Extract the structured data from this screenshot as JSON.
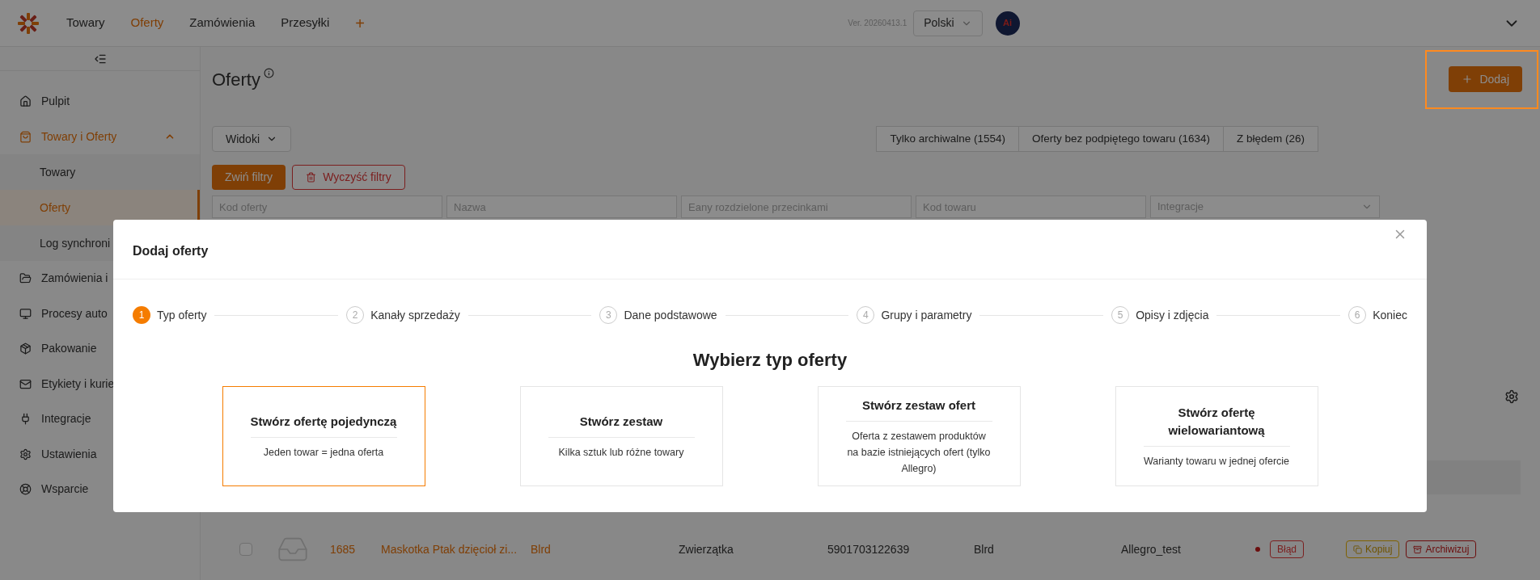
{
  "topbar": {
    "nav": [
      {
        "label": "Towary",
        "selected": false
      },
      {
        "label": "Oferty",
        "selected": true
      },
      {
        "label": "Zamówienia",
        "selected": false
      },
      {
        "label": "Przesyłki",
        "selected": false
      }
    ],
    "add_tab": "+",
    "version": "Ver. 20260413.1",
    "language": "Polski",
    "avatar_label": "Ai"
  },
  "sidebar": {
    "items": [
      {
        "label": "Pulpit",
        "active": false
      },
      {
        "label": "Towary i Oferty",
        "active": true,
        "expanded": true,
        "children": [
          {
            "label": "Towary",
            "selected": false
          },
          {
            "label": "Oferty",
            "selected": true
          },
          {
            "label": "Log synchroni",
            "selected": false
          }
        ]
      },
      {
        "label": "Zamówienia i",
        "active": false
      },
      {
        "label": "Procesy auto",
        "active": false
      },
      {
        "label": "Pakowanie",
        "active": false
      },
      {
        "label": "Etykiety i kurie",
        "active": false
      },
      {
        "label": "Integracje",
        "active": false
      },
      {
        "label": "Ustawienia",
        "active": false
      },
      {
        "label": "Wsparcie",
        "active": false
      }
    ]
  },
  "page": {
    "title": "Oferty",
    "add_button": "Dodaj",
    "views_button": "Widoki",
    "quick_filters": [
      "Tylko archiwalne (1554)",
      "Oferty bez podpiętego towaru (1634)",
      "Z błędem (26)"
    ],
    "collapse_filters": "Zwiń filtry",
    "clear_filters": "Wyczyść filtry",
    "filters": [
      {
        "kind": "input",
        "placeholder": "Kod oferty"
      },
      {
        "kind": "input",
        "placeholder": "Nazwa"
      },
      {
        "kind": "input",
        "placeholder": "Eany rozdzielone przecinkami"
      },
      {
        "kind": "input",
        "placeholder": "Kod towaru"
      },
      {
        "kind": "select",
        "placeholder": "Integracje"
      }
    ],
    "row": {
      "checked": false,
      "id": "1685",
      "name": "Maskotka Ptak dzięcioł zi...",
      "code": "Blrd",
      "category": "Zwierzątka",
      "ean": "5901703122639",
      "code_2": "Blrd",
      "integration": "Allegro_test",
      "status": "Błąd",
      "copy": "Kopiuj",
      "archive": "Archiwizuj"
    }
  },
  "modal": {
    "title": "Dodaj oferty",
    "steps": [
      {
        "number": "1",
        "label": "Typ oferty",
        "selected": true
      },
      {
        "number": "2",
        "label": "Kanały sprzedaży",
        "selected": false
      },
      {
        "number": "3",
        "label": "Dane podstawowe",
        "selected": false
      },
      {
        "number": "4",
        "label": "Grupy i parametry",
        "selected": false
      },
      {
        "number": "5",
        "label": "Opisy i zdjęcia",
        "selected": false
      },
      {
        "number": "6",
        "label": "Koniec",
        "selected": false
      }
    ],
    "heading": "Wybierz typ oferty",
    "options": [
      {
        "title": "Stwórz ofertę pojedynczą",
        "description": "Jeden towar = jedna oferta",
        "selected": true
      },
      {
        "title": "Stwórz zestaw",
        "description": "Kilka sztuk lub różne towary",
        "selected": false
      },
      {
        "title": "Stwórz zestaw ofert",
        "description": "Oferta z zestawem produktów na bazie istniejących ofert (tylko Allegro)",
        "selected": false
      },
      {
        "title": "Stwórz ofertę wielowariantową",
        "description": "Warianty towaru w jednej ofercie",
        "selected": false
      }
    ]
  }
}
